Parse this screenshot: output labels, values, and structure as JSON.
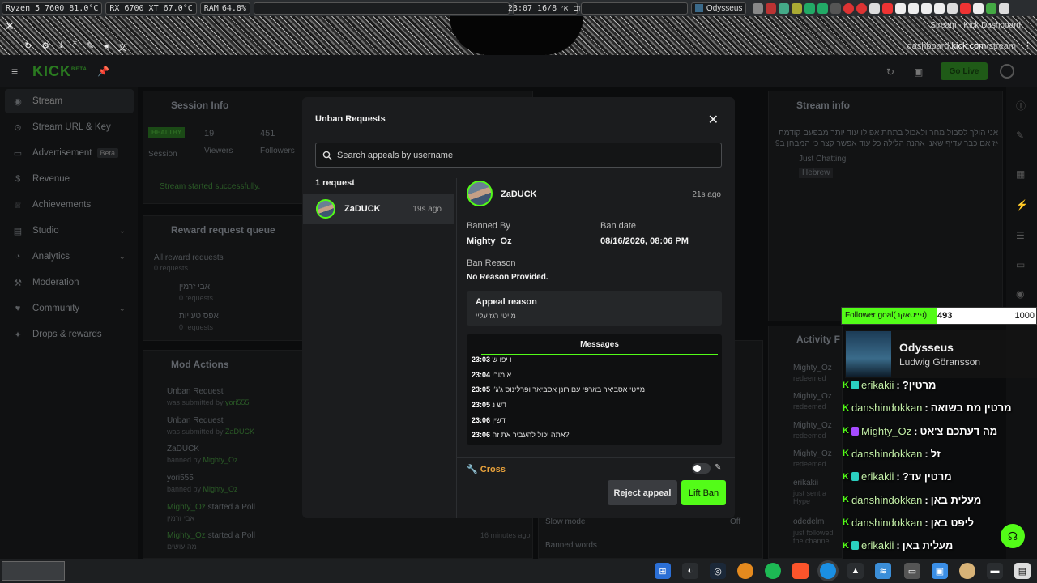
{
  "sysbar": {
    "cpu": "Ryzen 5 7600  81.0°C",
    "gpu": "RX 6700 XT  67.0°C",
    "ram_label": "RAM",
    "ram_value": "64.8%",
    "datetime": "23:07  יום א׳  16/8",
    "media_title": "Odysseus"
  },
  "browser": {
    "window_title": "Stream - Kick Dashboard",
    "url_prefix": "dashboard.",
    "url_host": "kick.com",
    "url_path": "/stream"
  },
  "app": {
    "logo": "KICK",
    "logo_sup": "BETA",
    "go_live": "Go Live"
  },
  "sidebar": {
    "items": [
      {
        "label": "Stream",
        "icon": "broadcast-icon"
      },
      {
        "label": "Stream URL & Key",
        "icon": "link-icon"
      },
      {
        "label": "Advertisement",
        "icon": "ad-icon",
        "badge": "Beta"
      },
      {
        "label": "Revenue",
        "icon": "dollar-icon"
      },
      {
        "label": "Achievements",
        "icon": "trophy-icon"
      },
      {
        "label": "Studio",
        "icon": "studio-icon"
      },
      {
        "label": "Analytics",
        "icon": "chart-icon"
      },
      {
        "label": "Moderation",
        "icon": "wrench-icon"
      },
      {
        "label": "Community",
        "icon": "community-icon"
      },
      {
        "label": "Drops & rewards",
        "icon": "gift-icon"
      }
    ]
  },
  "bg": {
    "session_info": "Session Info",
    "healthy": "HEALTHY",
    "session": "Session",
    "viewers_count": "19",
    "viewers": "Viewers",
    "followers_count": "451",
    "followers": "Followers",
    "stream_started": "Stream started successfully.",
    "reward_queue": "Reward request queue",
    "all_reward_requests": "All reward requests",
    "zero_requests": "0 requests",
    "reward1": "אבי זרמין",
    "reward2": "אפס טעויות",
    "mod_actions": "Mod Actions",
    "mod": [
      {
        "title": "Unban Request",
        "sub_pre": "was submitted by ",
        "sub_user": "yori555"
      },
      {
        "title": "Unban Request",
        "sub_pre": "was submitted by ",
        "sub_user": "ZaDUCK"
      },
      {
        "title": "ZaDUCK",
        "sub_pre": "banned by ",
        "sub_user": "Mighty_Oz"
      },
      {
        "title": "yori555",
        "sub_pre": "banned by ",
        "sub_user": "Mighty_Oz"
      },
      {
        "title_user": "Mighty_Oz",
        "title": " started a Poll",
        "sub_pre": "אבי זרמין"
      },
      {
        "title_user": "Mighty_Oz",
        "title": " started a Poll",
        "sub_pre": "מה עושים"
      }
    ],
    "mod_time": "16 minutes ago",
    "stream_info": "Stream info",
    "stream_desc1": "אני הולך לסבול מחר ולאכול בתחת אפילו עוד יותר מבפעם קודמת",
    "stream_desc2": "אז אם כבר עדיף שאני אהנה הלילה כל עוד אפשר קצר כי המבחן ב9",
    "category": "Just Chatting",
    "language": "Hebrew",
    "activity": "Activity F",
    "slow_mode": "Slow mode",
    "slow_mode_val": "Off",
    "banned_words": "Banned words",
    "act_users": [
      "Mighty_Oz",
      "Mighty_Oz",
      "Mighty_Oz",
      "Mighty_Oz",
      "erikakii",
      "odedelm"
    ],
    "act_sub": [
      "redeemed",
      "redeemed",
      "redeemed",
      "redeemed",
      "just sent a Hype",
      "just followed the channel"
    ]
  },
  "modal": {
    "title": "Unban Requests",
    "search_placeholder": "Search appeals by username",
    "request_count": "1 request",
    "request": {
      "username": "ZaDUCK",
      "time": "19s ago"
    },
    "detail": {
      "username": "ZaDUCK",
      "time": "21s ago",
      "banned_by_label": "Banned By",
      "banned_by": "Mighty_Oz",
      "ban_date_label": "Ban date",
      "ban_date": "08/16/2026, 08:06 PM",
      "ban_reason_label": "Ban Reason",
      "ban_reason": "No Reason Provided.",
      "appeal_reason_label": "Appeal reason",
      "appeal_reason": "מייטי רגז עליי"
    },
    "messages_tab": "Messages",
    "messages": [
      {
        "time": "23:03",
        "text": "ו יפו ש"
      },
      {
        "time": "23:04",
        "text": "אומורי"
      },
      {
        "time": "23:05",
        "text": "מייטי אסביאר בארפי עם רונן אסביאר ופרלינוס ג'ג'י"
      },
      {
        "time": "23:05",
        "text": "דש נ"
      },
      {
        "time": "23:06",
        "text": "דשין"
      },
      {
        "time": "23:06",
        "text": "אתה יכול להעביר את זה?"
      }
    ],
    "moderator_name": "Cross",
    "reject_label": "Reject appeal",
    "lift_label": "Lift Ban"
  },
  "overlay": {
    "follower_goal_label": "Follower goal(פייסאקר):",
    "follower_current": "493",
    "follower_max": "1000",
    "follower_progress": 0.493,
    "song": "Odysseus",
    "artist": "Ludwig Göransson",
    "chat": [
      {
        "user": "erikakii",
        "msg": "?מרטין",
        "badge": "#2ad0c0"
      },
      {
        "user": "danshindokkan",
        "msg": "מרטין מת בשואה",
        "badge": ""
      },
      {
        "user": "Mighty_Oz",
        "msg": "מה דעתכם צ'אט",
        "badge": "#a64bff"
      },
      {
        "user": "danshindokkan",
        "msg": "זל",
        "badge": ""
      },
      {
        "user": "erikakii",
        "msg": "?מרטין עד",
        "badge": "#2ad0c0"
      },
      {
        "user": "danshindokkan",
        "msg": "מעלית באן",
        "badge": ""
      },
      {
        "user": "danshindokkan",
        "msg": "ליפט באן",
        "badge": ""
      },
      {
        "user": "erikakii",
        "msg": "מעלית באן",
        "badge": "#2ad0c0"
      }
    ]
  },
  "colors": {
    "accent": "#53fc18",
    "modal_bg": "#1b1c1e",
    "reject_bg": "#3a3c40",
    "moderator": "#e9a23b"
  }
}
